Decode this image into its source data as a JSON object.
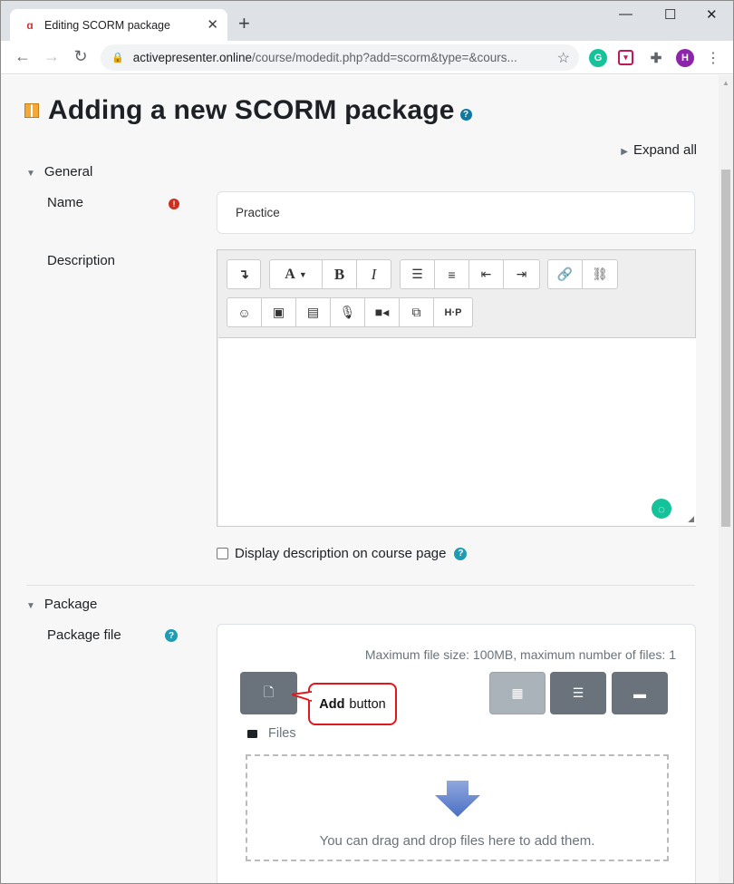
{
  "browser": {
    "tab_title": "Editing SCORM package",
    "tab_close": "✕",
    "new_tab": "+",
    "window_minimize": "—",
    "window_maximize": "☐",
    "window_close": "✕",
    "url_host": "activepresenter.online",
    "url_path": "/course/modedit.php?add=scorm&type=&cours...",
    "profile_initial": "H"
  },
  "page": {
    "title": "Adding a new SCORM package",
    "expand_all": "Expand all",
    "general": {
      "section_label": "General",
      "name_label": "Name",
      "name_value": "Practice",
      "description_label": "Description",
      "display_description_label": "Display description on course page"
    },
    "package": {
      "section_label": "Package",
      "package_file_label": "Package file",
      "max_info": "Maximum file size: 100MB, maximum number of files: 1",
      "files_label": "Files",
      "drop_text": "You can drag and drop files here to add them.",
      "callout_bold": "Add",
      "callout_text": "button"
    },
    "editor_toolbar": {
      "row1": [
        "more-toolbar",
        "font-color",
        "bold",
        "italic",
        "bullet-list",
        "numbered-list",
        "outdent",
        "indent",
        "link",
        "unlink"
      ],
      "row2": [
        "emoji",
        "image",
        "media",
        "record-audio",
        "record-video",
        "manage-files",
        "h5p"
      ]
    }
  },
  "colors": {
    "brand": "#1177a0",
    "required": "#ca3120",
    "button_gray": "#6a737b",
    "callout_border": "#e0181e",
    "grammarly": "#15c39a"
  }
}
